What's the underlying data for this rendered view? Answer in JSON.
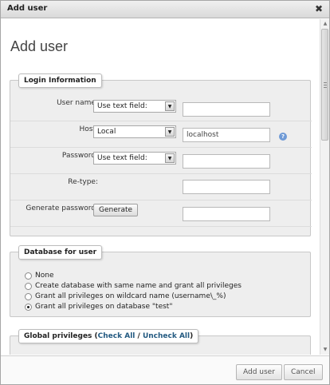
{
  "dialog": {
    "title": "Add user",
    "close_glyph": "✖",
    "close_icon": "close-icon"
  },
  "page": {
    "title": "Add user"
  },
  "login": {
    "legend": "Login Information",
    "username_label": "User name:",
    "username_select": "Use text field:",
    "username_value": "",
    "host_label": "Host:",
    "host_select": "Local",
    "host_value": "localhost",
    "help_glyph": "?",
    "help_icon": "help-icon",
    "password_label": "Password:",
    "password_select": "Use text field:",
    "password_value": "",
    "retype_label": "Re-type:",
    "retype_value": "",
    "generate_label": "Generate password:",
    "generate_button": "Generate",
    "generated_value": "",
    "select_arrow": "▼"
  },
  "database": {
    "legend": "Database for user",
    "options": [
      {
        "label": "None",
        "checked": false
      },
      {
        "label": "Create database with same name and grant all privileges",
        "checked": false
      },
      {
        "label": "Grant all privileges on wildcard name (username\\_%)",
        "checked": false
      },
      {
        "label": "Grant all privileges on database \"test\"",
        "checked": true
      }
    ]
  },
  "global": {
    "legend_prefix": "Global privileges (",
    "check_all": "Check All",
    "separator": " / ",
    "uncheck_all": "Uncheck All",
    "legend_suffix": ")"
  },
  "scrollbar": {
    "up_glyph": "▲",
    "down_glyph": "▼"
  },
  "footer": {
    "add_user_button": "Add user",
    "cancel_button": "Cancel"
  }
}
